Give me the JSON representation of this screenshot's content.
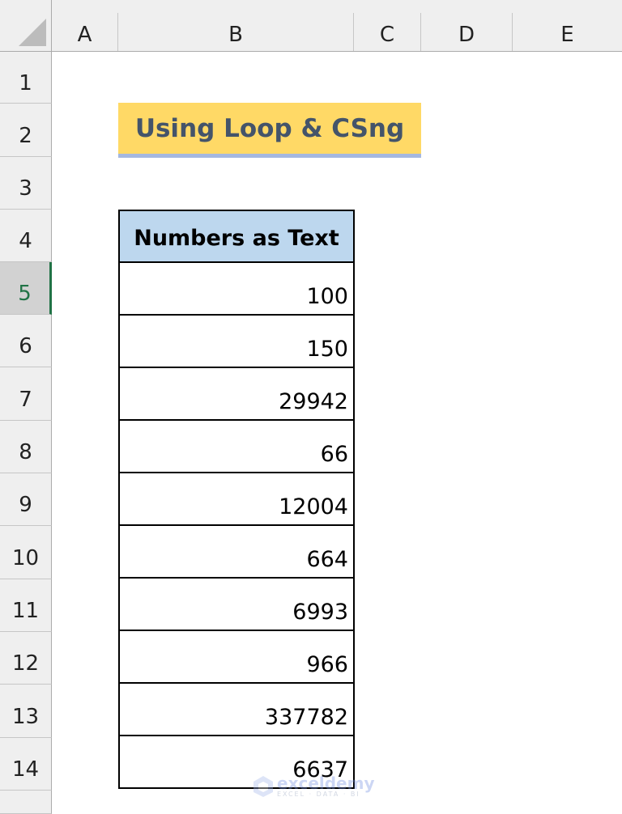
{
  "columns": [
    "A",
    "B",
    "C",
    "D",
    "E"
  ],
  "rows": [
    "1",
    "2",
    "3",
    "4",
    "5",
    "6",
    "7",
    "8",
    "9",
    "10",
    "11",
    "12",
    "13",
    "14"
  ],
  "selected_row": "5",
  "title": "Using Loop & CSng",
  "table": {
    "header": "Numbers as Text",
    "values": [
      "100",
      "150",
      "29942",
      "66",
      "12004",
      "664",
      "6993",
      "966",
      "337782",
      "6637"
    ]
  },
  "watermark": {
    "brand": "exceldemy",
    "tagline": "EXCEL · DATA · BI"
  },
  "colors": {
    "title_fill": "#ffd966",
    "title_text": "#44546a",
    "header_fill": "#bdd7ee",
    "selection_accent": "#217346"
  }
}
